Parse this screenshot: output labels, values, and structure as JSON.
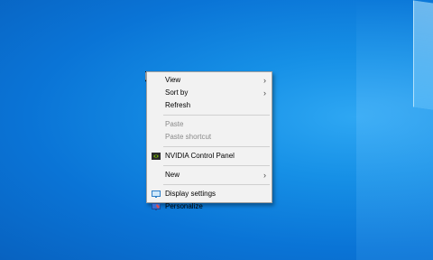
{
  "desktop": {
    "background": "#0a74d6"
  },
  "context_menu": {
    "groups": [
      [
        {
          "label": "View",
          "submenu": true,
          "enabled": true
        },
        {
          "label": "Sort by",
          "submenu": true,
          "enabled": true
        },
        {
          "label": "Refresh",
          "submenu": false,
          "enabled": true
        }
      ],
      [
        {
          "label": "Paste",
          "submenu": false,
          "enabled": false
        },
        {
          "label": "Paste shortcut",
          "submenu": false,
          "enabled": false
        }
      ],
      [
        {
          "label": "NVIDIA Control Panel",
          "icon": "nvidia-icon",
          "enabled": true
        }
      ],
      [
        {
          "label": "New",
          "submenu": true,
          "enabled": true
        }
      ],
      [
        {
          "label": "Display settings",
          "icon": "display-settings-icon",
          "enabled": true
        },
        {
          "label": "Personalize",
          "icon": "personalize-icon",
          "enabled": true
        }
      ]
    ]
  }
}
